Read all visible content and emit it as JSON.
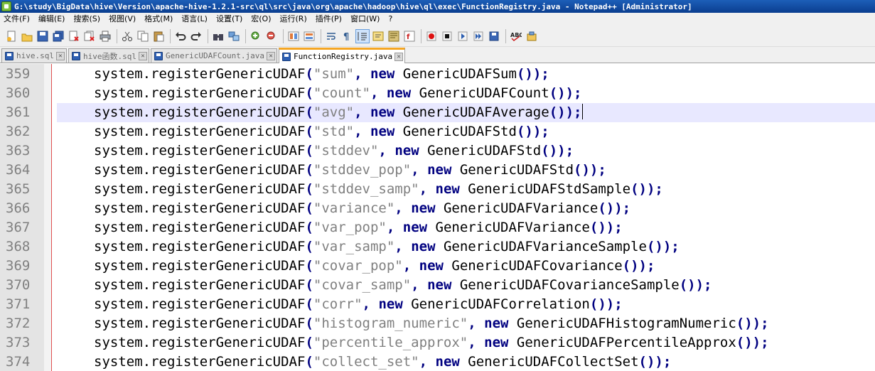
{
  "window": {
    "title": "G:\\study\\BigData\\hive\\Version\\apache-hive-1.2.1-src\\ql\\src\\java\\org\\apache\\hadoop\\hive\\ql\\exec\\FunctionRegistry.java - Notepad++ [Administrator]"
  },
  "menu": [
    "文件(F)",
    "编辑(E)",
    "搜索(S)",
    "视图(V)",
    "格式(M)",
    "语言(L)",
    "设置(T)",
    "宏(O)",
    "运行(R)",
    "插件(P)",
    "窗口(W)",
    "?"
  ],
  "tabs": [
    {
      "label": "hive.sql",
      "active": false
    },
    {
      "label": "hive函数.sql",
      "active": false
    },
    {
      "label": "GenericUDAFCount.java",
      "active": false
    },
    {
      "label": "FunctionRegistry.java",
      "active": true
    }
  ],
  "editor": {
    "current_line": "361",
    "lines": [
      {
        "num": "359",
        "obj": "system",
        "method": "registerGenericUDAF",
        "name": "\"sum\"",
        "kw": "new",
        "cls": "GenericUDAFSum"
      },
      {
        "num": "360",
        "obj": "system",
        "method": "registerGenericUDAF",
        "name": "\"count\"",
        "kw": "new",
        "cls": "GenericUDAFCount"
      },
      {
        "num": "361",
        "obj": "system",
        "method": "registerGenericUDAF",
        "name": "\"avg\"",
        "kw": "new",
        "cls": "GenericUDAFAverage"
      },
      {
        "num": "362",
        "obj": "system",
        "method": "registerGenericUDAF",
        "name": "\"std\"",
        "kw": "new",
        "cls": "GenericUDAFStd"
      },
      {
        "num": "363",
        "obj": "system",
        "method": "registerGenericUDAF",
        "name": "\"stddev\"",
        "kw": "new",
        "cls": "GenericUDAFStd"
      },
      {
        "num": "364",
        "obj": "system",
        "method": "registerGenericUDAF",
        "name": "\"stddev_pop\"",
        "kw": "new",
        "cls": "GenericUDAFStd"
      },
      {
        "num": "365",
        "obj": "system",
        "method": "registerGenericUDAF",
        "name": "\"stddev_samp\"",
        "kw": "new",
        "cls": "GenericUDAFStdSample"
      },
      {
        "num": "366",
        "obj": "system",
        "method": "registerGenericUDAF",
        "name": "\"variance\"",
        "kw": "new",
        "cls": "GenericUDAFVariance"
      },
      {
        "num": "367",
        "obj": "system",
        "method": "registerGenericUDAF",
        "name": "\"var_pop\"",
        "kw": "new",
        "cls": "GenericUDAFVariance"
      },
      {
        "num": "368",
        "obj": "system",
        "method": "registerGenericUDAF",
        "name": "\"var_samp\"",
        "kw": "new",
        "cls": "GenericUDAFVarianceSample"
      },
      {
        "num": "369",
        "obj": "system",
        "method": "registerGenericUDAF",
        "name": "\"covar_pop\"",
        "kw": "new",
        "cls": "GenericUDAFCovariance"
      },
      {
        "num": "370",
        "obj": "system",
        "method": "registerGenericUDAF",
        "name": "\"covar_samp\"",
        "kw": "new",
        "cls": "GenericUDAFCovarianceSample"
      },
      {
        "num": "371",
        "obj": "system",
        "method": "registerGenericUDAF",
        "name": "\"corr\"",
        "kw": "new",
        "cls": "GenericUDAFCorrelation"
      },
      {
        "num": "372",
        "obj": "system",
        "method": "registerGenericUDAF",
        "name": "\"histogram_numeric\"",
        "kw": "new",
        "cls": "GenericUDAFHistogramNumeric"
      },
      {
        "num": "373",
        "obj": "system",
        "method": "registerGenericUDAF",
        "name": "\"percentile_approx\"",
        "kw": "new",
        "cls": "GenericUDAFPercentileApprox"
      },
      {
        "num": "374",
        "obj": "system",
        "method": "registerGenericUDAF",
        "name": "\"collect_set\"",
        "kw": "new",
        "cls": "GenericUDAFCollectSet"
      }
    ]
  },
  "colors": {
    "title_bar": "#0a3d8f",
    "keyword": "#000080",
    "string": "#808080",
    "current_line_bg": "#e8e8ff",
    "active_tab_accent": "#f5a623",
    "edge_line": "#e05050"
  }
}
